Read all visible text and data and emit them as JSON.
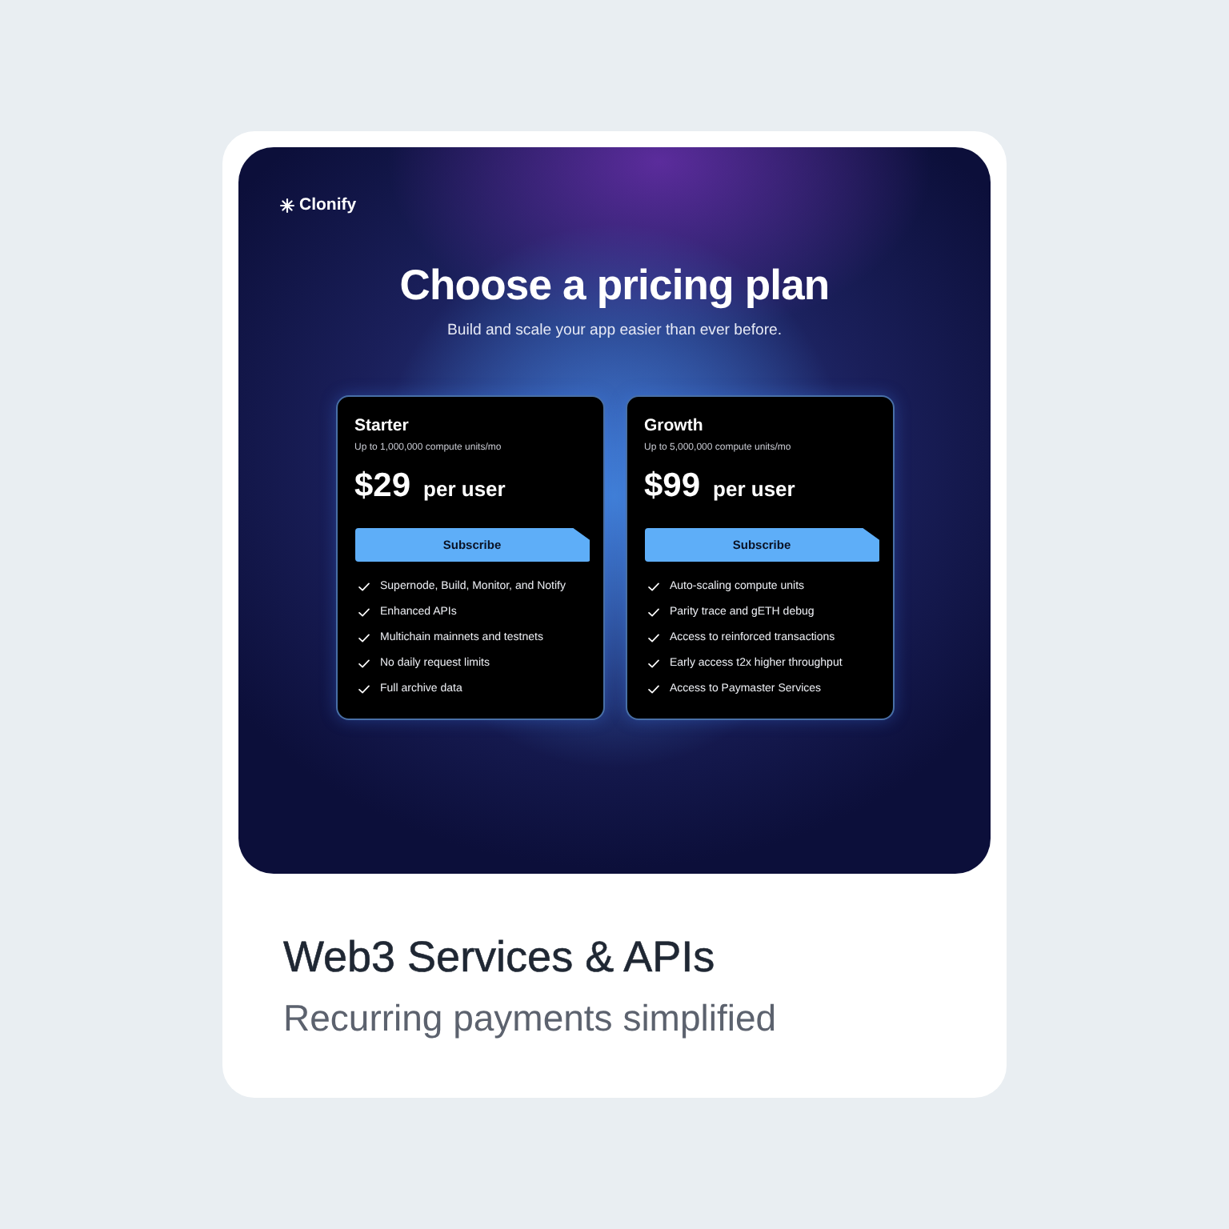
{
  "product_card": {
    "preview": {
      "logo": "Clonify",
      "heading": "Choose a pricing plan",
      "subheading": "Build and scale your app easier than ever before.",
      "plans": [
        {
          "name": "Starter",
          "quota": "Up to 1,000,000 compute units/mo",
          "price": "$29",
          "unit": "per user",
          "button": "Subscribe",
          "features": [
            "Supernode, Build, Monitor, and Notify",
            "Enhanced APIs",
            "Multichain mainnets and testnets",
            "No daily request limits",
            "Full archive data"
          ]
        },
        {
          "name": "Growth",
          "quota": "Up to 5,000,000 compute units/mo",
          "price": "$99",
          "unit": "per user",
          "button": "Subscribe",
          "features": [
            "Auto-scaling compute units",
            "Parity trace and gETH debug",
            "Access to reinforced transactions",
            "Early access t2x higher throughput",
            "Access to Paymaster Services"
          ]
        }
      ]
    },
    "title": "Web3 Services & APIs",
    "subtitle": "Recurring payments simplified"
  }
}
